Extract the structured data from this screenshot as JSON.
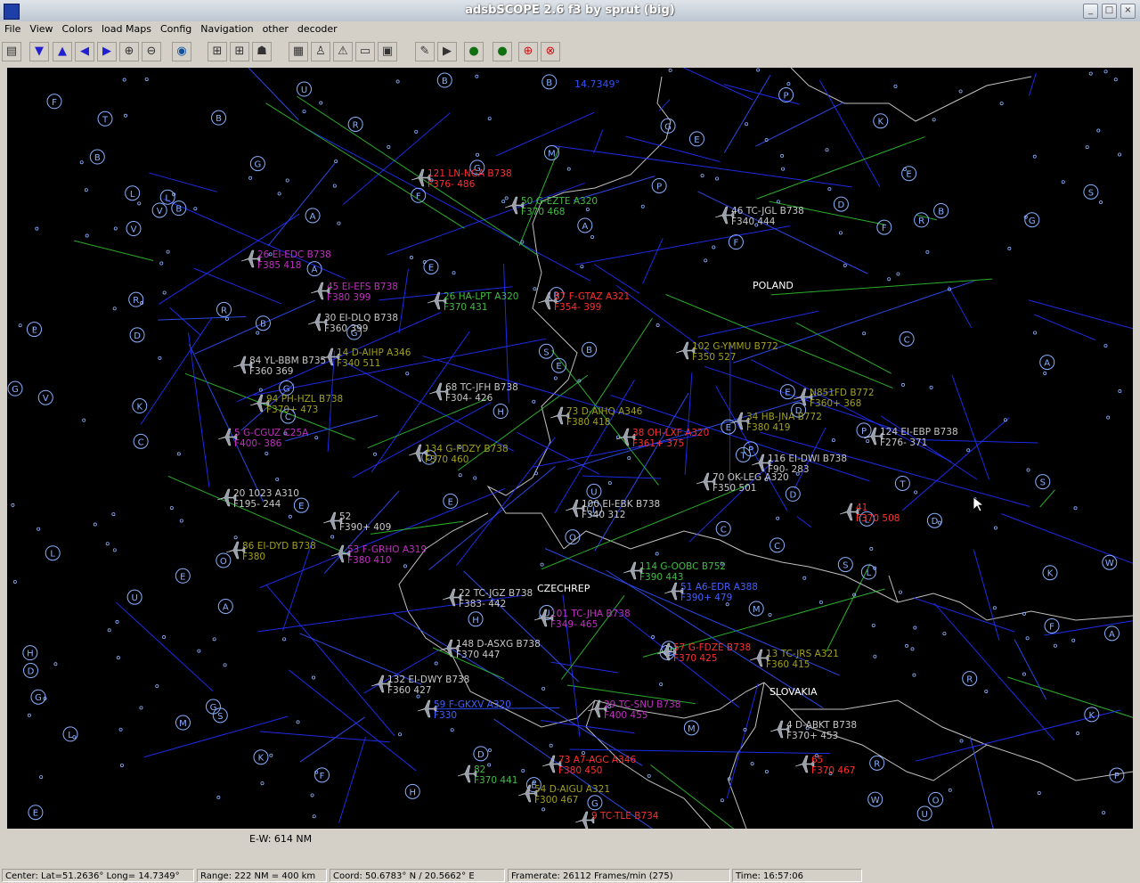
{
  "window": {
    "title": "adsbSCOPE 2.6 f3 by sprut  (big)"
  },
  "menu": [
    "File",
    "View",
    "Colors",
    "load Maps",
    "Config",
    "Navigation",
    "other",
    "decoder"
  ],
  "toolbar_icons": [
    "table-icon",
    "arrow-down-icon",
    "arrow-up-icon",
    "arrow-left-icon",
    "arrow-right-icon",
    "zoom-in-icon",
    "zoom-out-icon",
    "globe-icon",
    "network-icon",
    "network2-icon",
    "people-icon",
    "chart-icon",
    "person-icon",
    "warning-icon",
    "document-icon",
    "monitor-icon",
    "tools-icon",
    "play-icon",
    "record-dot-icon",
    "record-dot2-icon",
    "target-icon",
    "target2-icon"
  ],
  "map": {
    "center_longitude_label": "14.7349°",
    "country_labels": [
      "POLAND",
      "CZECHREP",
      "SLOVAKIA"
    ],
    "aircraft": [
      {
        "l1": "121  LN-NGA  B738",
        "l2": "F376-  486",
        "c": "#ff3030"
      },
      {
        "l1": "50  G-EZTE  A320",
        "l2": "F370  468",
        "c": "#44bb44"
      },
      {
        "l1": "46  TC-JGL  B738",
        "l2": "F340  444",
        "c": "#c8c8c8"
      },
      {
        "l1": "26  EI-EDC  B738",
        "l2": "F385  418",
        "c": "#c030c0"
      },
      {
        "l1": "45  EI-EFS  B738",
        "l2": "F380  399",
        "c": "#c030c0"
      },
      {
        "l1": "26  HA-LPT  A320",
        "l2": "F370  431",
        "c": "#44bb44"
      },
      {
        "l1": "87  F-GTAZ  A321",
        "l2": "F354-  399",
        "c": "#ff3030"
      },
      {
        "l1": "30  EI-DLQ  B738",
        "l2": "F360  399",
        "c": "#c8c8c8"
      },
      {
        "l1": "14  D-AIHP  A346",
        "l2": "F340  511",
        "c": "#a0a020"
      },
      {
        "l1": "84  YL-BBM  B735",
        "l2": "F360  369",
        "c": "#c8c8c8"
      },
      {
        "l1": "102  G-YMMU  B772",
        "l2": "F350  527",
        "c": "#a0a020"
      },
      {
        "l1": "68  TC-JFH  B738",
        "l2": "F304-  426",
        "c": "#c8c8c8"
      },
      {
        "l1": "94  PH-HZL  B738",
        "l2": "F370+  473",
        "c": "#a0a020"
      },
      {
        "l1": "73  D-AIHQ  A346",
        "l2": "F380  418",
        "c": "#a0a020"
      },
      {
        "l1": "38  OH-LXF  A320",
        "l2": "F361+  375",
        "c": "#ff3030"
      },
      {
        "l1": "34  HB-JNA  B772",
        "l2": "F380  419",
        "c": "#a0a020"
      },
      {
        "l1": "N851FD  B772",
        "l2": "F360+  368",
        "c": "#a0a020"
      },
      {
        "l1": "124  EI-EBP  B738",
        "l2": "F276-  371",
        "c": "#c8c8c8"
      },
      {
        "l1": "5  G-CGUZ  C25A",
        "l2": "F400-  386",
        "c": "#c030c0"
      },
      {
        "l1": "134  G-FDZY  B738",
        "l2": "F370  460",
        "c": "#a0a020"
      },
      {
        "l1": "116  EI-DWI  B738",
        "l2": "F90-  283",
        "c": "#c8c8c8"
      },
      {
        "l1": "70  OK-LEG  A320",
        "l2": "F350  501",
        "c": "#c8c8c8"
      },
      {
        "l1": "20  1023  A310",
        "l2": "F195-  244",
        "c": "#c8c8c8"
      },
      {
        "l1": "100  EI-EBK  B738",
        "l2": "F340  312",
        "c": "#c8c8c8"
      },
      {
        "l1": "41",
        "l2": "F370  508",
        "c": "#ff3030"
      },
      {
        "l1": "52",
        "l2": "F390+  409",
        "c": "#c8c8c8"
      },
      {
        "l1": "86  EI-DYD  B738",
        "l2": "F380",
        "c": "#a0a020"
      },
      {
        "l1": "53  F-GRHO  A319",
        "l2": "F380  410",
        "c": "#c030c0"
      },
      {
        "l1": "114  G-OOBC  B752",
        "l2": "F390  443",
        "c": "#44bb44"
      },
      {
        "l1": "51  A6-EDR  A388",
        "l2": "F390+  479",
        "c": "#4060ff"
      },
      {
        "l1": "22  TC-JGZ  B738",
        "l2": "F383-  442",
        "c": "#c8c8c8"
      },
      {
        "l1": "101  TC-JHA  B738",
        "l2": "F349-  465",
        "c": "#c030c0"
      },
      {
        "l1": "148  D-ASXG  B738",
        "l2": "F370  447",
        "c": "#c8c8c8"
      },
      {
        "l1": "57  G-FDZE  B738",
        "l2": "F370  425",
        "c": "#ff3030"
      },
      {
        "l1": "13  TC-JRS  A321",
        "l2": "F360  415",
        "c": "#a0a020"
      },
      {
        "l1": "132  EI-DWY  B738",
        "l2": "F360  427",
        "c": "#c8c8c8"
      },
      {
        "l1": "59  F-GKXV  A320",
        "l2": "F330",
        "c": "#4060ff"
      },
      {
        "l1": "29  TC-SNU  B738",
        "l2": "F400  455",
        "c": "#c030c0"
      },
      {
        "l1": "4  D-ABKT  B738",
        "l2": "F370+  453",
        "c": "#c8c8c8"
      },
      {
        "l1": "65",
        "l2": "F370  467",
        "c": "#ff3030"
      },
      {
        "l1": "73  A7-AGC  A346",
        "l2": "F380  450",
        "c": "#ff3030"
      },
      {
        "l1": "82",
        "l2": "F370  441",
        "c": "#44bb44"
      },
      {
        "l1": "54  D-AIGU  A321",
        "l2": "F300  467",
        "c": "#a0a020"
      },
      {
        "l1": "9  TC-TLE  B734",
        "l2": "",
        "c": "#ff3030"
      }
    ]
  },
  "scale_label": "E-W: 614 NM",
  "status": {
    "center": "Center: Lat=51.2636° Long= 14.7349°",
    "range": "Range: 222 NM = 400 km",
    "coord": "Coord: 50.6783° N / 20.5662° E",
    "framerate": "Framerate:  26112 Frames/min (275)",
    "time": "Time: 16:57:06"
  }
}
